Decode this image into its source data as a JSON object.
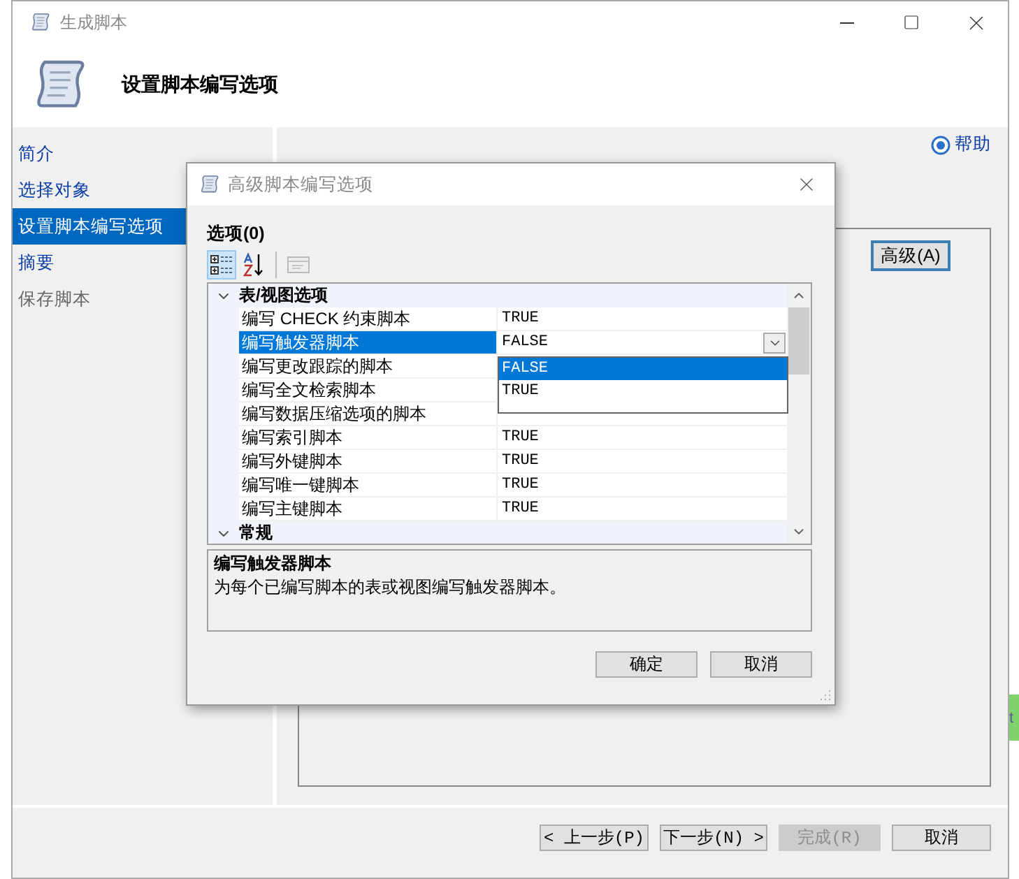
{
  "window": {
    "title": "生成脚本",
    "header": "设置脚本编写选项"
  },
  "sidebar": {
    "items": [
      {
        "label": "简介",
        "selected": false,
        "disabled": false
      },
      {
        "label": "选择对象",
        "selected": false,
        "disabled": false
      },
      {
        "label": "设置脚本编写选项",
        "selected": true,
        "disabled": false
      },
      {
        "label": "摘要",
        "selected": false,
        "disabled": false
      },
      {
        "label": "保存脚本",
        "selected": false,
        "disabled": true
      }
    ]
  },
  "help": "帮助",
  "advanced_button": "高级(A)",
  "nav_buttons": [
    {
      "label": "< 上一步(P)",
      "disabled": false
    },
    {
      "label": "下一步(N) >",
      "disabled": false
    },
    {
      "label": "完成(R)",
      "disabled": true
    },
    {
      "label": "取消",
      "disabled": false
    }
  ],
  "dialog": {
    "title": "高级脚本编写选项",
    "options_label": "选项(0)",
    "toolbar": [
      {
        "kind": "categorized",
        "selected": true,
        "disabled": false
      },
      {
        "kind": "alphabetical",
        "selected": false,
        "disabled": false
      },
      {
        "kind": "property_pages",
        "selected": false,
        "disabled": true
      }
    ],
    "grid": {
      "categories": [
        {
          "label": "表/视图选项",
          "expanded": true,
          "properties": [
            {
              "name": "编写 CHECK 约束脚本",
              "value": "TRUE",
              "selected": false
            },
            {
              "name": "编写触发器脚本",
              "value": "FALSE",
              "selected": true,
              "dropdown": {
                "options": [
                  {
                    "label": "FALSE",
                    "selected": true
                  },
                  {
                    "label": "TRUE",
                    "selected": false
                  }
                ]
              }
            },
            {
              "name": "编写更改跟踪的脚本",
              "selected": false
            },
            {
              "name": "编写全文检索脚本",
              "selected": false
            },
            {
              "name": "编写数据压缩选项的脚本",
              "selected": false
            },
            {
              "name": "编写索引脚本",
              "value": "TRUE",
              "selected": false
            },
            {
              "name": "编写外键脚本",
              "value": "TRUE",
              "selected": false
            },
            {
              "name": "编写唯一键脚本",
              "value": "TRUE",
              "selected": false
            },
            {
              "name": "编写主键脚本",
              "value": "TRUE",
              "selected": false
            }
          ]
        },
        {
          "label": "常规",
          "expanded": true
        }
      ]
    },
    "description": {
      "title": "编写触发器脚本",
      "text": "为每个已编写脚本的表或视图编写触发器脚本。"
    },
    "buttons": [
      "确定",
      "取消"
    ]
  },
  "side_tab": "t"
}
